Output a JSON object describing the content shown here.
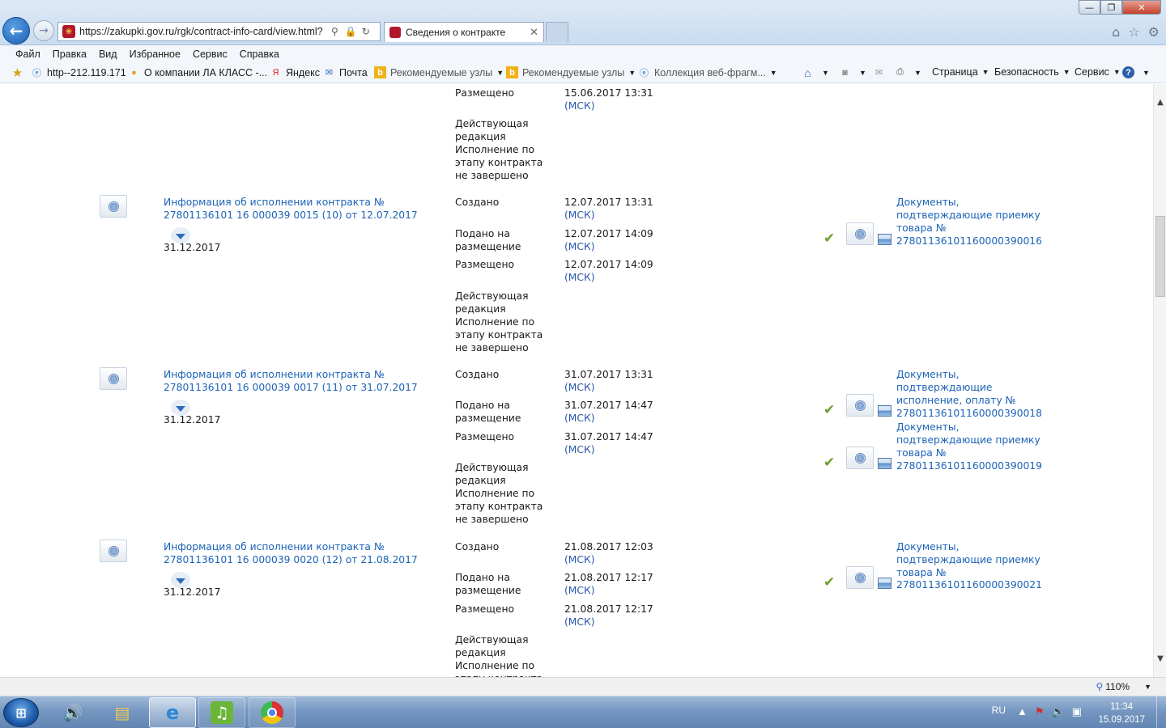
{
  "browser": {
    "url": "https://zakupki.gov.ru/rgk/contract-info-card/view.html?",
    "tab_title": "Сведения о контракте",
    "tab_close": "✕",
    "window_min": "—",
    "window_max": "❐",
    "window_close": "✕"
  },
  "menu": [
    "Файл",
    "Правка",
    "Вид",
    "Избранное",
    "Сервис",
    "Справка"
  ],
  "favorites": {
    "items": [
      {
        "label": "http--212.119.171",
        "icon": "ie-page-icon"
      },
      {
        "label": "О компании ЛА КЛАСС -...",
        "icon": "user-icon"
      },
      {
        "label": "Яндекс",
        "icon": "yandex-icon"
      },
      {
        "label": "Почта",
        "icon": "mail-icon"
      },
      {
        "label": "Рекомендуемые узлы",
        "icon": "bing-icon"
      },
      {
        "label": "Рекомендуемые узлы",
        "icon": "bing-icon"
      },
      {
        "label": "Коллекция веб-фрагм...",
        "icon": "ie-page-icon"
      }
    ],
    "commands": [
      "Страница",
      "Безопасность",
      "Сервис"
    ]
  },
  "top_partial": {
    "placed_label": "Размещено",
    "placed_date": "15.06.2017 13:31",
    "placed_tz": "(МСК)",
    "status": [
      "Действующая",
      "редакция",
      "Исполнение по",
      "этапу контракта",
      "не завершено"
    ]
  },
  "labels": {
    "created": "Создано",
    "submitted": [
      "Подано на",
      "размещение"
    ],
    "placed": "Размещено",
    "tz": "(МСК)",
    "status": [
      "Действующая",
      "редакция",
      "Исполнение по",
      "этапу контракта",
      "не завершено"
    ]
  },
  "records": [
    {
      "title1": "Информация об исполнении контракта №",
      "title2": "27801136101 16 000039 0015 (10) от 12.07.2017",
      "end_date": "31.12.2017",
      "created": "12.07.2017 13:31",
      "submitted": "12.07.2017 14:09",
      "placed": "12.07.2017 14:09",
      "docs": [
        {
          "lines": [
            "Документы,",
            "подтверждающие приемку",
            "товара №",
            "27801136101160000390016"
          ]
        }
      ]
    },
    {
      "title1": "Информация об исполнении контракта №",
      "title2": "27801136101 16 000039 0017 (11) от 31.07.2017",
      "end_date": "31.12.2017",
      "created": "31.07.2017 13:31",
      "submitted": "31.07.2017 14:47",
      "placed": "31.07.2017 14:47",
      "docs": [
        {
          "lines": [
            "Документы,",
            "подтверждающие",
            "исполнение, оплату №",
            "27801136101160000390018"
          ]
        },
        {
          "lines": [
            "Документы,",
            "подтверждающие приемку",
            "товара №",
            "27801136101160000390019"
          ]
        }
      ]
    },
    {
      "title1": "Информация об исполнении контракта №",
      "title2": "27801136101 16 000039 0020 (12) от 21.08.2017",
      "end_date": "31.12.2017",
      "created": "21.08.2017 12:03",
      "submitted": "21.08.2017 12:17",
      "placed": "21.08.2017 12:17",
      "docs": [
        {
          "lines": [
            "Документы,",
            "подтверждающие приемку",
            "товара №",
            "27801136101160000390021"
          ]
        }
      ]
    }
  ],
  "status_bar": {
    "zoom": "110%"
  },
  "taskbar": {
    "lang": "RU",
    "time": "11:34",
    "date": "15.09.2017"
  },
  "colors": {
    "link": "#1c63b7",
    "check": "#6a9e2d",
    "taskbar": "#7597c1"
  }
}
